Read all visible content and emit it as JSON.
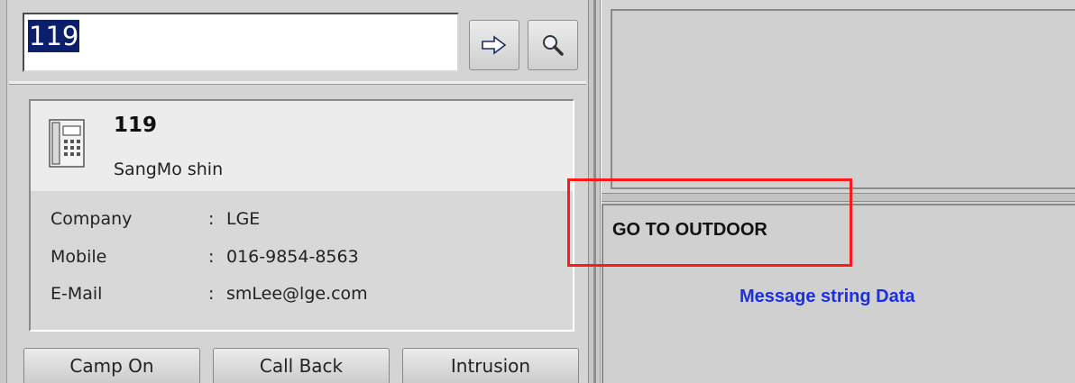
{
  "dial": {
    "input_value": "119",
    "send_icon": "arrow-right-icon",
    "search_icon": "magnifier-icon"
  },
  "contact": {
    "icon": "desk-phone-icon",
    "number": "119",
    "name": "SangMo shin",
    "fields": [
      {
        "label": "Company",
        "colon": ":",
        "value": "LGE"
      },
      {
        "label": "Mobile",
        "colon": ":",
        "value": "016-9854-8563"
      },
      {
        "label": "E-Mail",
        "colon": ":",
        "value": "smLee@lge.com"
      }
    ]
  },
  "actions": {
    "camp_on": "Camp On",
    "call_back": "Call Back",
    "intrusion": "Intrusion"
  },
  "message": {
    "text": "GO TO OUTDOOR"
  },
  "annotation": {
    "label": "Message string Data",
    "highlight_color": "#ff1a1a",
    "label_color": "#1a2fe6"
  }
}
